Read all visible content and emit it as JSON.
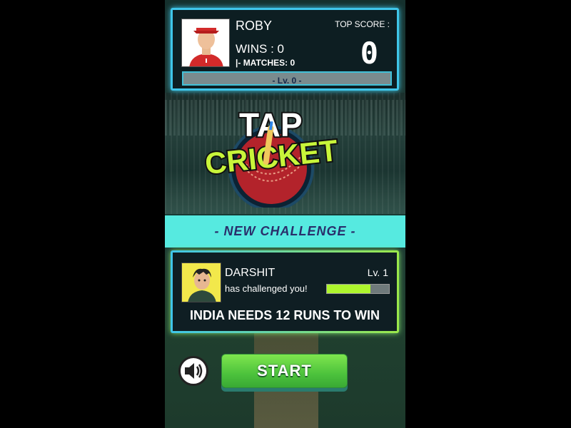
{
  "profile": {
    "name": "ROBY",
    "wins": "WINS : 0",
    "matches": "|- MATCHES: 0",
    "top_score_label": "TOP SCORE :",
    "top_score": "0",
    "level": "- Lv. 0 -"
  },
  "logo": {
    "line1": "TAP",
    "line2": "CRICKET"
  },
  "banner": {
    "label": "- NEW CHALLENGE -"
  },
  "challenge": {
    "name": "DARSHIT",
    "subtitle": "has challenged you!",
    "level": "Lv. 1",
    "progress": 0.7,
    "target": "INDIA NEEDS 12 RUNS TO WIN"
  },
  "buttons": {
    "start": "START",
    "sound_icon": "speaker-icon"
  },
  "colors": {
    "accent_cyan": "#56eae0",
    "start_green": "#4cc23c",
    "progress_green": "#aef52d"
  }
}
